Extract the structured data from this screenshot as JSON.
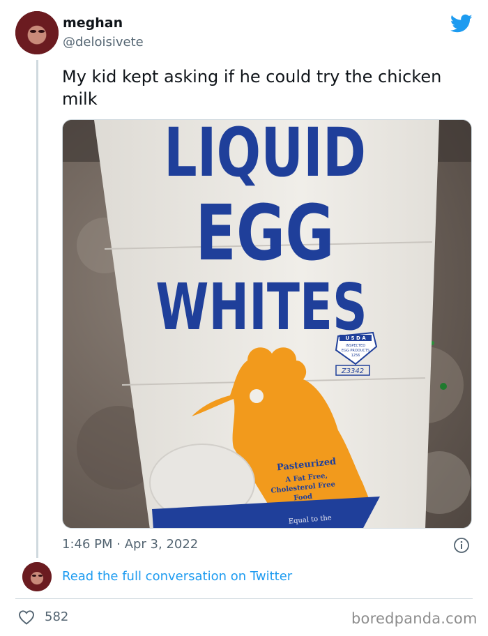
{
  "tweet": {
    "display_name": "meghan",
    "handle": "@deloisivete",
    "text": "My kid kept asking if he could try the chicken milk",
    "timestamp": "1:46 PM · Apr 3, 2022",
    "read_link": "Read the full conversation on Twitter",
    "likes": "582"
  },
  "photo": {
    "carton_lines": [
      "LIQUID",
      "EGG",
      "WHITES"
    ],
    "usda_top": "U S D A",
    "usda_lines": [
      "INSPECTED",
      "EGG PRODUCTS",
      "1256"
    ],
    "code": "Z3342",
    "pasteurized": "Pasteurized",
    "fat_free_lines": [
      "A Fat Free,",
      "Cholesterol Free",
      "Food"
    ],
    "equal": "Equal to the"
  },
  "watermark": "boredpanda.com",
  "colors": {
    "twitter_blue": "#1d9bf0",
    "carton_blue": "#1f3f9a",
    "hen_orange": "#f29a1c"
  },
  "icons": {
    "brand": "twitter-bird-icon",
    "info": "info-icon",
    "like": "heart-icon"
  }
}
